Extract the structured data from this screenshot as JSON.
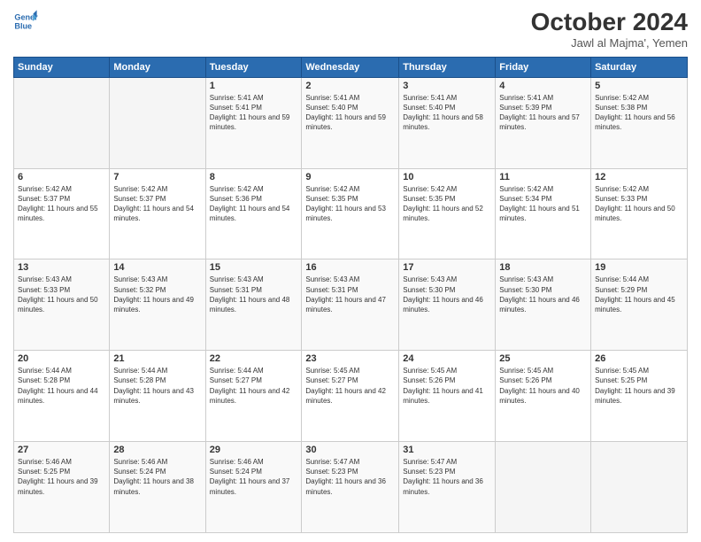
{
  "header": {
    "logo_line1": "General",
    "logo_line2": "Blue",
    "month": "October 2024",
    "location": "Jawl al Majma', Yemen"
  },
  "weekdays": [
    "Sunday",
    "Monday",
    "Tuesday",
    "Wednesday",
    "Thursday",
    "Friday",
    "Saturday"
  ],
  "weeks": [
    [
      {
        "day": "",
        "info": ""
      },
      {
        "day": "",
        "info": ""
      },
      {
        "day": "1",
        "info": "Sunrise: 5:41 AM\nSunset: 5:41 PM\nDaylight: 11 hours and 59 minutes."
      },
      {
        "day": "2",
        "info": "Sunrise: 5:41 AM\nSunset: 5:40 PM\nDaylight: 11 hours and 59 minutes."
      },
      {
        "day": "3",
        "info": "Sunrise: 5:41 AM\nSunset: 5:40 PM\nDaylight: 11 hours and 58 minutes."
      },
      {
        "day": "4",
        "info": "Sunrise: 5:41 AM\nSunset: 5:39 PM\nDaylight: 11 hours and 57 minutes."
      },
      {
        "day": "5",
        "info": "Sunrise: 5:42 AM\nSunset: 5:38 PM\nDaylight: 11 hours and 56 minutes."
      }
    ],
    [
      {
        "day": "6",
        "info": "Sunrise: 5:42 AM\nSunset: 5:37 PM\nDaylight: 11 hours and 55 minutes."
      },
      {
        "day": "7",
        "info": "Sunrise: 5:42 AM\nSunset: 5:37 PM\nDaylight: 11 hours and 54 minutes."
      },
      {
        "day": "8",
        "info": "Sunrise: 5:42 AM\nSunset: 5:36 PM\nDaylight: 11 hours and 54 minutes."
      },
      {
        "day": "9",
        "info": "Sunrise: 5:42 AM\nSunset: 5:35 PM\nDaylight: 11 hours and 53 minutes."
      },
      {
        "day": "10",
        "info": "Sunrise: 5:42 AM\nSunset: 5:35 PM\nDaylight: 11 hours and 52 minutes."
      },
      {
        "day": "11",
        "info": "Sunrise: 5:42 AM\nSunset: 5:34 PM\nDaylight: 11 hours and 51 minutes."
      },
      {
        "day": "12",
        "info": "Sunrise: 5:42 AM\nSunset: 5:33 PM\nDaylight: 11 hours and 50 minutes."
      }
    ],
    [
      {
        "day": "13",
        "info": "Sunrise: 5:43 AM\nSunset: 5:33 PM\nDaylight: 11 hours and 50 minutes."
      },
      {
        "day": "14",
        "info": "Sunrise: 5:43 AM\nSunset: 5:32 PM\nDaylight: 11 hours and 49 minutes."
      },
      {
        "day": "15",
        "info": "Sunrise: 5:43 AM\nSunset: 5:31 PM\nDaylight: 11 hours and 48 minutes."
      },
      {
        "day": "16",
        "info": "Sunrise: 5:43 AM\nSunset: 5:31 PM\nDaylight: 11 hours and 47 minutes."
      },
      {
        "day": "17",
        "info": "Sunrise: 5:43 AM\nSunset: 5:30 PM\nDaylight: 11 hours and 46 minutes."
      },
      {
        "day": "18",
        "info": "Sunrise: 5:43 AM\nSunset: 5:30 PM\nDaylight: 11 hours and 46 minutes."
      },
      {
        "day": "19",
        "info": "Sunrise: 5:44 AM\nSunset: 5:29 PM\nDaylight: 11 hours and 45 minutes."
      }
    ],
    [
      {
        "day": "20",
        "info": "Sunrise: 5:44 AM\nSunset: 5:28 PM\nDaylight: 11 hours and 44 minutes."
      },
      {
        "day": "21",
        "info": "Sunrise: 5:44 AM\nSunset: 5:28 PM\nDaylight: 11 hours and 43 minutes."
      },
      {
        "day": "22",
        "info": "Sunrise: 5:44 AM\nSunset: 5:27 PM\nDaylight: 11 hours and 42 minutes."
      },
      {
        "day": "23",
        "info": "Sunrise: 5:45 AM\nSunset: 5:27 PM\nDaylight: 11 hours and 42 minutes."
      },
      {
        "day": "24",
        "info": "Sunrise: 5:45 AM\nSunset: 5:26 PM\nDaylight: 11 hours and 41 minutes."
      },
      {
        "day": "25",
        "info": "Sunrise: 5:45 AM\nSunset: 5:26 PM\nDaylight: 11 hours and 40 minutes."
      },
      {
        "day": "26",
        "info": "Sunrise: 5:45 AM\nSunset: 5:25 PM\nDaylight: 11 hours and 39 minutes."
      }
    ],
    [
      {
        "day": "27",
        "info": "Sunrise: 5:46 AM\nSunset: 5:25 PM\nDaylight: 11 hours and 39 minutes."
      },
      {
        "day": "28",
        "info": "Sunrise: 5:46 AM\nSunset: 5:24 PM\nDaylight: 11 hours and 38 minutes."
      },
      {
        "day": "29",
        "info": "Sunrise: 5:46 AM\nSunset: 5:24 PM\nDaylight: 11 hours and 37 minutes."
      },
      {
        "day": "30",
        "info": "Sunrise: 5:47 AM\nSunset: 5:23 PM\nDaylight: 11 hours and 36 minutes."
      },
      {
        "day": "31",
        "info": "Sunrise: 5:47 AM\nSunset: 5:23 PM\nDaylight: 11 hours and 36 minutes."
      },
      {
        "day": "",
        "info": ""
      },
      {
        "day": "",
        "info": ""
      }
    ]
  ]
}
